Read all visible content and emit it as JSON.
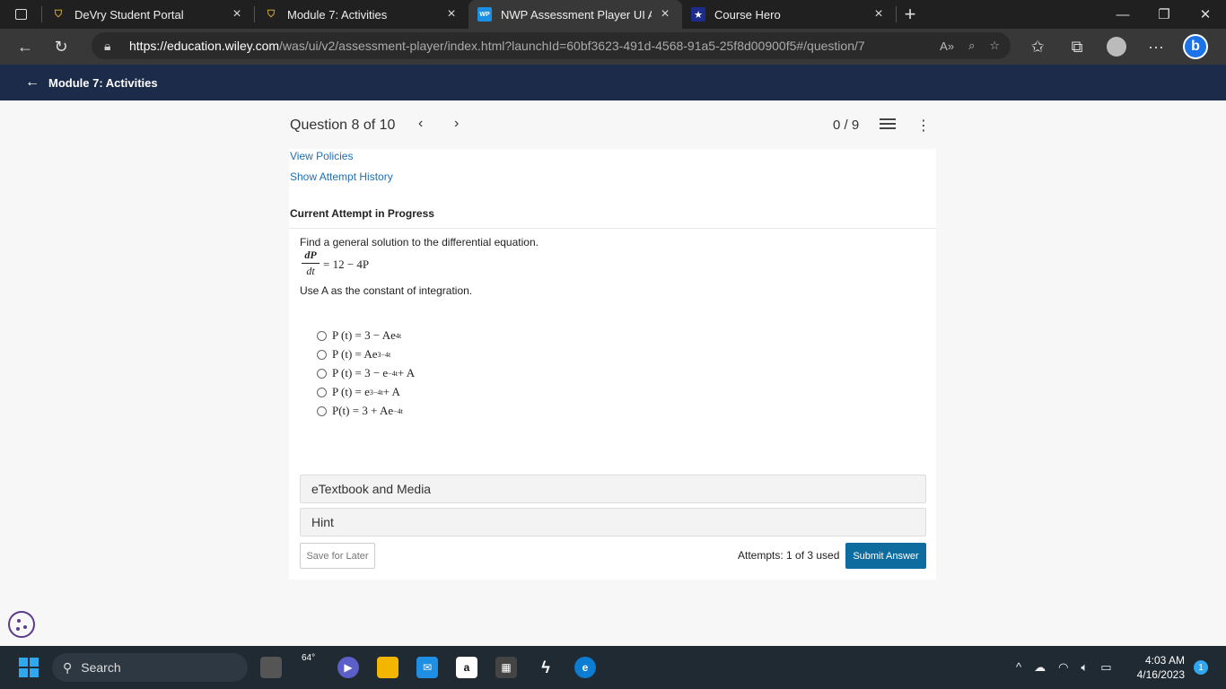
{
  "browser": {
    "tabs": [
      {
        "title": "DeVry Student Portal",
        "active": false
      },
      {
        "title": "Module 7: Activities",
        "active": false
      },
      {
        "title": "NWP Assessment Player UI Appli",
        "active": true,
        "favicon_text": "WP"
      },
      {
        "title": "Course Hero",
        "active": false
      }
    ],
    "url_host": "https://education.wiley.com",
    "url_path": "/was/ui/v2/assessment-player/index.html?launchId=60bf3623-491d-4568-91a5-25f8d00900f5#/question/7"
  },
  "app_header": {
    "back_label": "Module 7: Activities"
  },
  "question_header": {
    "title": "Question 8 of 10",
    "score": "0 / 9"
  },
  "links": {
    "view_policies": "View Policies",
    "show_history": "Show Attempt History"
  },
  "attempt_title": "Current Attempt in Progress",
  "question": {
    "prompt": "Find a general solution to the differential equation.",
    "frac_num": "dP",
    "frac_den": "dt",
    "rhs": "= 12 − 4P",
    "instruction": "Use A as the constant of integration."
  },
  "options": [
    {
      "base": "P (t) = 3 − Ae",
      "sup": "4t",
      "tail": ""
    },
    {
      "base": "P (t) = Ae",
      "sup": "3−4t",
      "tail": ""
    },
    {
      "base": "P (t) = 3 − e",
      "sup": "−4t",
      "tail": " + A"
    },
    {
      "base": "P (t) = e",
      "sup": "3−4t",
      "tail": " + A"
    },
    {
      "base": "P(t) = 3 + Ae",
      "sup": "−4t",
      "tail": ""
    }
  ],
  "accordions": {
    "etextbook": "eTextbook and Media",
    "hint": "Hint"
  },
  "footer": {
    "save_label": "Save for Later",
    "attempts": "Attempts: 1 of 3 used",
    "submit_label": "Submit Answer"
  },
  "taskbar": {
    "search_label": "Search",
    "weather": "64°",
    "time": "4:03 AM",
    "date": "4/16/2023",
    "notifications": "1"
  },
  "colors": {
    "app_header": "#1c2b4a",
    "link": "#1f6fb2",
    "submit": "#0f6c9e"
  }
}
